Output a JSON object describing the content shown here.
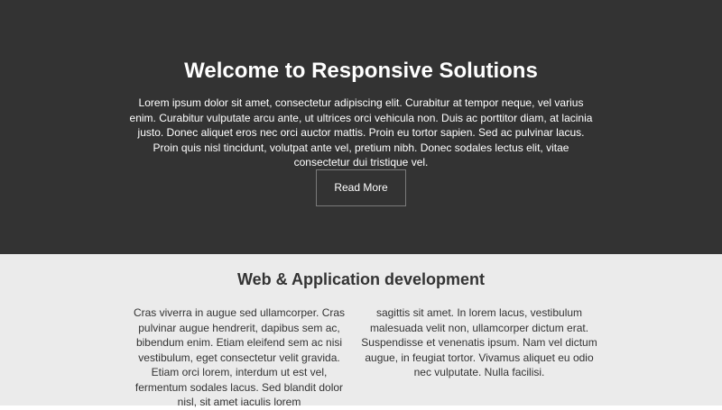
{
  "hero": {
    "title": "Welcome to Responsive Solutions",
    "text": "Lorem ipsum dolor sit amet, consectetur adipiscing elit. Curabitur at tempor neque, vel varius enim. Curabitur vulputate arcu ante, ut ultrices orci vehicula non. Duis ac porttitor diam, at lacinia justo. Donec aliquet eros nec orci auctor mattis. Proin eu tortor sapien. Sed ac pulvinar lacus. Proin quis nisl tincidunt, volutpat ante vel, pretium nibh. Donec sodales lectus elit, vitae consectetur dui tristique vel.",
    "button_label": "Read More"
  },
  "section": {
    "title": "Web & Application development",
    "col_left": "Cras viverra in augue sed ullamcorper. Cras pulvinar augue hendrerit, dapibus sem ac, bibendum enim. Etiam eleifend sem ac nisi vestibulum, eget consectetur velit gravida. Etiam orci lorem, interdum ut est vel, fermentum sodales lacus. Sed blandit dolor nisl, sit amet iaculis lorem",
    "col_right": "sagittis sit amet. In lorem lacus, vestibulum malesuada velit non, ullamcorper dictum erat. Suspendisse et venenatis ipsum. Nam vel dictum augue, in feugiat tortor. Vivamus aliquet eu odio nec vulputate. Nulla facilisi."
  },
  "colors": {
    "hero_bg": "#333333",
    "section_bg": "#ebebeb",
    "text_dark": "#333333",
    "text_light": "#ffffff"
  }
}
